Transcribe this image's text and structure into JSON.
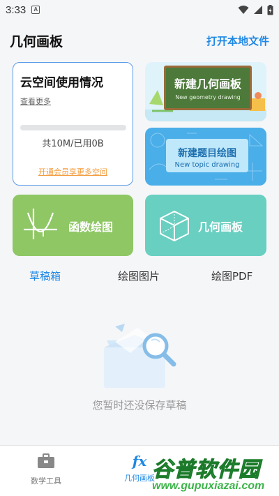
{
  "status_bar": {
    "time": "3:33",
    "notification_glyph": "A",
    "icons": [
      "wifi-icon",
      "signal-icon",
      "battery-icon"
    ]
  },
  "header": {
    "title": "几何画板",
    "open_local": "打开本地文件"
  },
  "cloud": {
    "title": "云空间使用情况",
    "more": "查看更多",
    "usage_fraction": 0,
    "usage": "共10M/已用0B",
    "vip_link": "开通会员享更多空间"
  },
  "new_geometry": {
    "title": "新建几何画板",
    "subtitle": "New geometry drawing"
  },
  "new_topic": {
    "title": "新建题目绘图",
    "subtitle": "New topic drawing"
  },
  "function_plot": {
    "label": "函数绘图"
  },
  "geometry_board": {
    "label": "几何画板"
  },
  "tabs": [
    {
      "label": "草稿箱",
      "active": true
    },
    {
      "label": "绘图图片",
      "active": false
    },
    {
      "label": "绘图PDF",
      "active": false
    }
  ],
  "empty_state": {
    "message": "您暂时还没保存草稿"
  },
  "bottom_nav": [
    {
      "label": "数学工具",
      "icon": "toolbox-icon",
      "active": false
    },
    {
      "label": "几何画板",
      "icon": "fx-icon",
      "active": true
    }
  ],
  "watermark": {
    "title": "谷普软件园",
    "url": "www.gupuxiazai.com"
  },
  "colors": {
    "accent": "#1e88e5",
    "function_card": "#8ec764",
    "geometry_card": "#69cfc1",
    "vip_link": "#f39c3d"
  }
}
